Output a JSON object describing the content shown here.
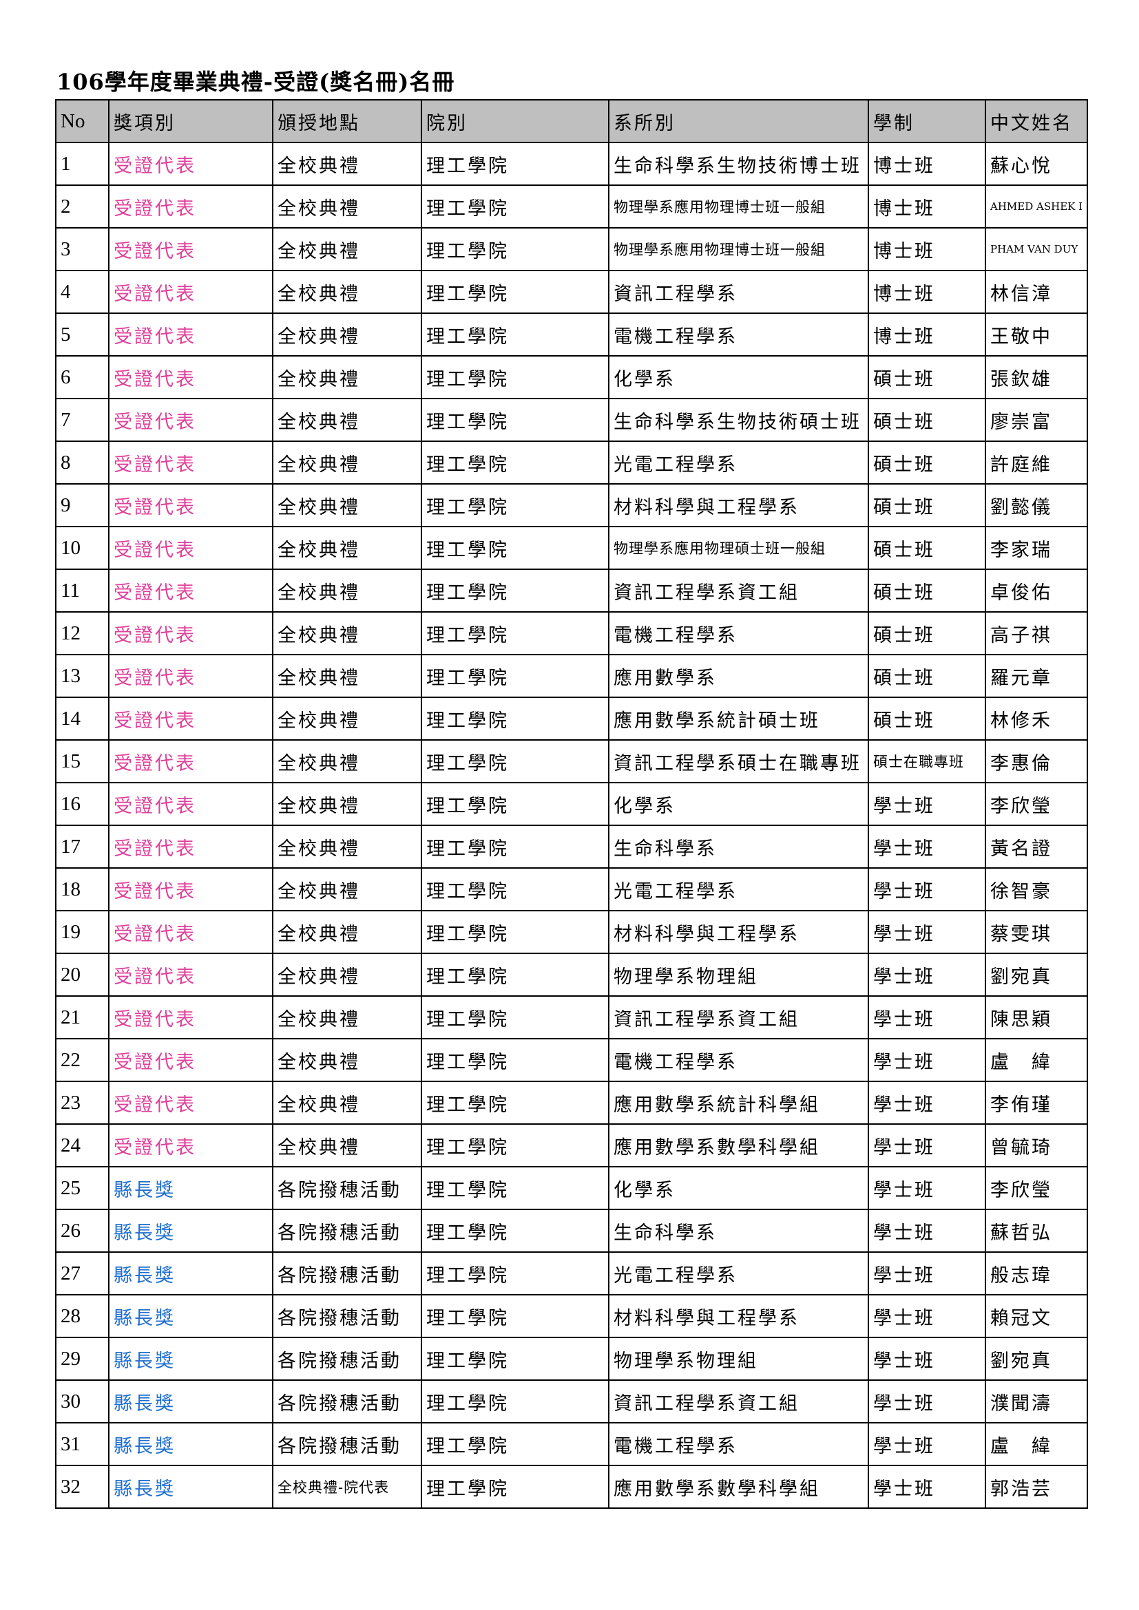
{
  "title": "106學年度畢業典禮-受證(獎名冊)名冊",
  "colors": {
    "award_rep": "#e0409a",
    "award_mayor": "#1f6fd0",
    "header_bg": "#bfbfbf"
  },
  "columns": [
    "No",
    "獎項別",
    "頒授地點",
    "院別",
    "系所別",
    "學制",
    "中文姓名"
  ],
  "rows": [
    {
      "no": "1",
      "award": "受證代表",
      "venue": "全校典禮",
      "college": "理工學院",
      "dept": "生命科學系生物技術博士班",
      "program": "博士班",
      "name": "蘇心悅"
    },
    {
      "no": "2",
      "award": "受證代表",
      "venue": "全校典禮",
      "college": "理工學院",
      "dept": "物理學系應用物理博士班一般組",
      "program": "博士班",
      "name": "AHMED ASHEK I"
    },
    {
      "no": "3",
      "award": "受證代表",
      "venue": "全校典禮",
      "college": "理工學院",
      "dept": "物理學系應用物理博士班一般組",
      "program": "博士班",
      "name": "PHAM VAN DUY"
    },
    {
      "no": "4",
      "award": "受證代表",
      "venue": "全校典禮",
      "college": "理工學院",
      "dept": "資訊工程學系",
      "program": "博士班",
      "name": "林信漳"
    },
    {
      "no": "5",
      "award": "受證代表",
      "venue": "全校典禮",
      "college": "理工學院",
      "dept": "電機工程學系",
      "program": "博士班",
      "name": "王敬中"
    },
    {
      "no": "6",
      "award": "受證代表",
      "venue": "全校典禮",
      "college": "理工學院",
      "dept": "化學系",
      "program": "碩士班",
      "name": "張欽雄"
    },
    {
      "no": "7",
      "award": "受證代表",
      "venue": "全校典禮",
      "college": "理工學院",
      "dept": "生命科學系生物技術碩士班",
      "program": "碩士班",
      "name": "廖崇富"
    },
    {
      "no": "8",
      "award": "受證代表",
      "venue": "全校典禮",
      "college": "理工學院",
      "dept": "光電工程學系",
      "program": "碩士班",
      "name": "許庭維"
    },
    {
      "no": "9",
      "award": "受證代表",
      "venue": "全校典禮",
      "college": "理工學院",
      "dept": "材料科學與工程學系",
      "program": "碩士班",
      "name": "劉懿儀"
    },
    {
      "no": "10",
      "award": "受證代表",
      "venue": "全校典禮",
      "college": "理工學院",
      "dept": "物理學系應用物理碩士班一般組",
      "program": "碩士班",
      "name": "李家瑞"
    },
    {
      "no": "11",
      "award": "受證代表",
      "venue": "全校典禮",
      "college": "理工學院",
      "dept": "資訊工程學系資工組",
      "program": "碩士班",
      "name": "卓俊佑"
    },
    {
      "no": "12",
      "award": "受證代表",
      "venue": "全校典禮",
      "college": "理工學院",
      "dept": "電機工程學系",
      "program": "碩士班",
      "name": "高子祺"
    },
    {
      "no": "13",
      "award": "受證代表",
      "venue": "全校典禮",
      "college": "理工學院",
      "dept": "應用數學系",
      "program": "碩士班",
      "name": "羅元章"
    },
    {
      "no": "14",
      "award": "受證代表",
      "venue": "全校典禮",
      "college": "理工學院",
      "dept": "應用數學系統計碩士班",
      "program": "碩士班",
      "name": "林修禾"
    },
    {
      "no": "15",
      "award": "受證代表",
      "venue": "全校典禮",
      "college": "理工學院",
      "dept": "資訊工程學系碩士在職專班",
      "program": "碩士在職專班",
      "name": "李惠倫"
    },
    {
      "no": "16",
      "award": "受證代表",
      "venue": "全校典禮",
      "college": "理工學院",
      "dept": "化學系",
      "program": "學士班",
      "name": "李欣瑩"
    },
    {
      "no": "17",
      "award": "受證代表",
      "venue": "全校典禮",
      "college": "理工學院",
      "dept": "生命科學系",
      "program": "學士班",
      "name": "黃名證"
    },
    {
      "no": "18",
      "award": "受證代表",
      "venue": "全校典禮",
      "college": "理工學院",
      "dept": "光電工程學系",
      "program": "學士班",
      "name": "徐智豪"
    },
    {
      "no": "19",
      "award": "受證代表",
      "venue": "全校典禮",
      "college": "理工學院",
      "dept": "材料科學與工程學系",
      "program": "學士班",
      "name": "蔡雯琪"
    },
    {
      "no": "20",
      "award": "受證代表",
      "venue": "全校典禮",
      "college": "理工學院",
      "dept": "物理學系物理組",
      "program": "學士班",
      "name": "劉宛真"
    },
    {
      "no": "21",
      "award": "受證代表",
      "venue": "全校典禮",
      "college": "理工學院",
      "dept": "資訊工程學系資工組",
      "program": "學士班",
      "name": "陳思穎"
    },
    {
      "no": "22",
      "award": "受證代表",
      "venue": "全校典禮",
      "college": "理工學院",
      "dept": "電機工程學系",
      "program": "學士班",
      "name": "盧　緯"
    },
    {
      "no": "23",
      "award": "受證代表",
      "venue": "全校典禮",
      "college": "理工學院",
      "dept": "應用數學系統計科學組",
      "program": "學士班",
      "name": "李侑瑾"
    },
    {
      "no": "24",
      "award": "受證代表",
      "venue": "全校典禮",
      "college": "理工學院",
      "dept": "應用數學系數學科學組",
      "program": "學士班",
      "name": "曾毓琦"
    },
    {
      "no": "25",
      "award": "縣長獎",
      "venue": "各院撥穗活動",
      "college": "理工學院",
      "dept": "化學系",
      "program": "學士班",
      "name": "李欣瑩"
    },
    {
      "no": "26",
      "award": "縣長獎",
      "venue": "各院撥穗活動",
      "college": "理工學院",
      "dept": "生命科學系",
      "program": "學士班",
      "name": "蘇哲弘"
    },
    {
      "no": "27",
      "award": "縣長獎",
      "venue": "各院撥穗活動",
      "college": "理工學院",
      "dept": "光電工程學系",
      "program": "學士班",
      "name": "般志瑋"
    },
    {
      "no": "28",
      "award": "縣長獎",
      "venue": "各院撥穗活動",
      "college": "理工學院",
      "dept": "材料科學與工程學系",
      "program": "學士班",
      "name": "賴冠文"
    },
    {
      "no": "29",
      "award": "縣長獎",
      "venue": "各院撥穗活動",
      "college": "理工學院",
      "dept": "物理學系物理組",
      "program": "學士班",
      "name": "劉宛真"
    },
    {
      "no": "30",
      "award": "縣長獎",
      "venue": "各院撥穗活動",
      "college": "理工學院",
      "dept": "資訊工程學系資工組",
      "program": "學士班",
      "name": "濮聞濤"
    },
    {
      "no": "31",
      "award": "縣長獎",
      "venue": "各院撥穗活動",
      "college": "理工學院",
      "dept": "電機工程學系",
      "program": "學士班",
      "name": "盧　緯"
    },
    {
      "no": "32",
      "award": "縣長獎",
      "venue": "全校典禮-院代表",
      "college": "理工學院",
      "dept": "應用數學系數學科學組",
      "program": "學士班",
      "name": "郭浩芸"
    }
  ]
}
